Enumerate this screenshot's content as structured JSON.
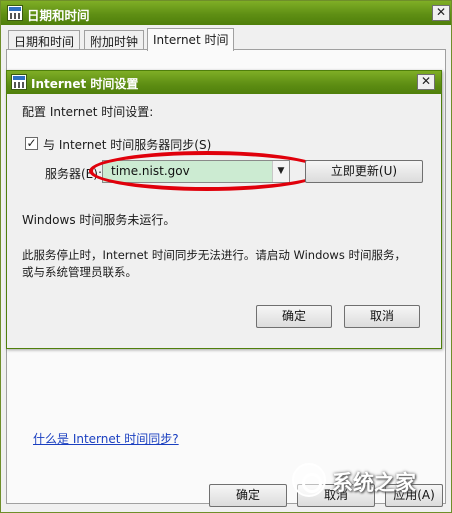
{
  "outer_window": {
    "title": "日期和时间",
    "close_glyph": "✕",
    "tabs": [
      {
        "label": "日期和时间"
      },
      {
        "label": "附加时钟"
      },
      {
        "label": "Internet 时间"
      }
    ],
    "help_link": "什么是 Internet 时间同步?",
    "buttons": {
      "ok": "确定",
      "cancel": "取消",
      "apply": "应用(A)"
    }
  },
  "dialog": {
    "title": "Internet 时间设置",
    "close_glyph": "✕",
    "configure_label": "配置 Internet 时间设置:",
    "sync_checkbox": {
      "checked": true,
      "check_glyph": "✓",
      "label": "与 Internet 时间服务器同步(S)"
    },
    "server_label": "服务器(E):",
    "server_value": "time.nist.gov",
    "dropdown_glyph": "▼",
    "update_button": "立即更新(U)",
    "status_text": "Windows 时间服务未运行。",
    "message_line1": "此服务停止时，Internet 时间同步无法进行。请启动 Windows 时间服务，",
    "message_line2": "或与系统管理员联系。",
    "buttons": {
      "ok": "确定",
      "cancel": "取消"
    }
  },
  "watermark": {
    "text": "系统之家"
  },
  "colors": {
    "titlebar": "#5f8f14",
    "highlight": "#e0000b",
    "combo_background": "#ccebd2",
    "link": "#1a3fc0"
  },
  "icons": {
    "window_icon": "calendar-clock-icon",
    "close": "close-icon",
    "dropdown": "chevron-down-icon",
    "check": "checkmark-icon"
  }
}
